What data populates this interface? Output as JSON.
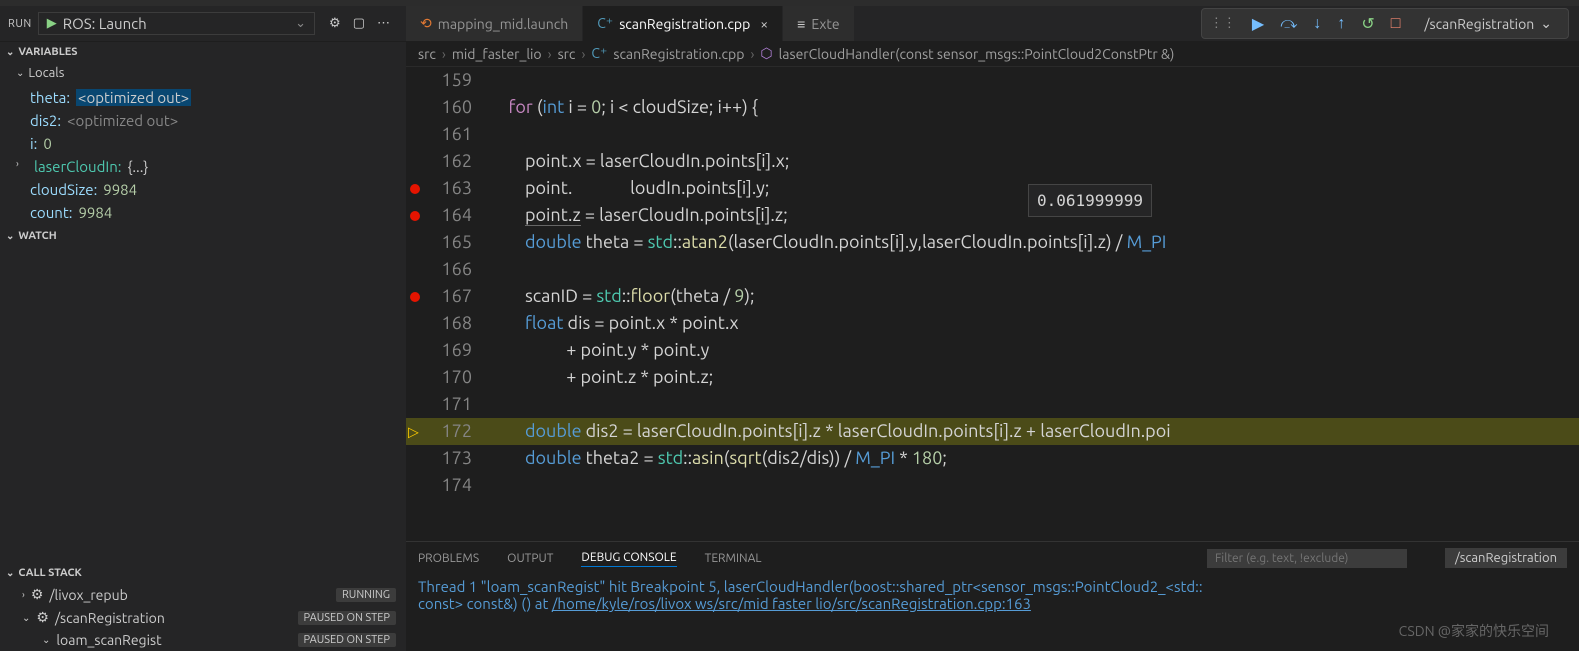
{
  "run": {
    "label": "RUN",
    "config": "ROS: Launch"
  },
  "sections": {
    "variables": "VARIABLES",
    "locals": "Locals",
    "watch": "WATCH",
    "callstack": "CALL STACK"
  },
  "vars": {
    "theta_name": "theta:",
    "theta_val": "<optimized out>",
    "dis2_name": "dis2:",
    "dis2_val": "<optimized out>",
    "i_name": "i:",
    "i_val": "0",
    "laser_name": "laserCloudIn:",
    "laser_val": "{...}",
    "cloudsize_name": "cloudSize:",
    "cloudsize_val": "9984",
    "count_name": "count:",
    "count_val": "9984"
  },
  "callstack": {
    "row1": {
      "name": "/livox_repub",
      "badge": "RUNNING"
    },
    "row2": {
      "name": "/scanRegistration",
      "badge": "PAUSED ON STEP"
    },
    "row3": {
      "name": "loam_scanRegist",
      "badge": "PAUSED ON STEP"
    }
  },
  "tabs": {
    "t1": "mapping_mid.launch",
    "t2": "scanRegistration.cpp",
    "t3": "Exte"
  },
  "debug_sel": "/scanRegistration",
  "breadcrumb": {
    "p1": "src",
    "p2": "mid_faster_lio",
    "p3": "src",
    "p4": "scanRegistration.cpp",
    "p5": "laserCloudHandler(const sensor_msgs::PointCloud2ConstPtr &)"
  },
  "hover": "0.061999999",
  "lines": {
    "l159": "159",
    "l160": "160",
    "l161": "161",
    "l162": "162",
    "l163": "163",
    "l164": "164",
    "l165": "165",
    "l166": "166",
    "l167": "167",
    "l168": "168",
    "l169": "169",
    "l170": "170",
    "l171": "171",
    "l172": "172",
    "l173": "173",
    "l174": "174"
  },
  "code": {
    "l160_for": "for",
    "l160_int": "int",
    "l160_rest1": " i = ",
    "l160_0": "0",
    "l160_rest2": "; i < cloudSize; i++) {",
    "l162": "point.x = laserCloudIn.points[i].x;",
    "l163": "point.",
    "l163b": "loudIn.points[i].y;",
    "l164": "point.z",
    "l164b": " = laserCloudIn.points[i].z;",
    "l165_dbl": "double",
    "l165_a": " theta = ",
    "l165_std": "std",
    "l165_atan": "atan2",
    "l165_b": "(laserCloudIn.points[i].y,laserCloudIn.points[i].z) / ",
    "l165_mpi": "M_PI",
    "l167_a": "scanID = ",
    "l167_std": "std",
    "l167_floor": "floor",
    "l167_b": "(theta / ",
    "l167_9": "9",
    "l167_c": ");",
    "l168_float": "float",
    "l168_a": " dis = point.x * point.x",
    "l169": "+ point.y * point.y",
    "l170": "+ point.z * point.z;",
    "l172_dbl": "double",
    "l172_a": " dis2 = laserCloudIn.points[i].z * laserCloudIn.points[i].z + laserCloudIn.poi",
    "l173_dbl": "double",
    "l173_a": " theta2 = ",
    "l173_std": "std",
    "l173_asin": "asin",
    "l173_b": "(",
    "l173_sqrt": "sqrt",
    "l173_c": "(dis2/dis)) / ",
    "l173_mpi": "M_PI",
    "l173_d": " * ",
    "l173_180": "180",
    "l173_e": ";"
  },
  "panel": {
    "problems": "PROBLEMS",
    "output": "OUTPUT",
    "debug": "DEBUG CONSOLE",
    "terminal": "TERMINAL",
    "filter_ph": "Filter (e.g. text, !exclude)",
    "sel": "/scanRegistration"
  },
  "console": {
    "l1a": "Thread 1 \"loam_scanRegist\" hit Breakpoint 5, laserCloudHandler(boost::shared_ptr<sensor_msgs::PointCloud2_<std::",
    "l2a": "const> const&) () at ",
    "l2b": "/home/kyle/ros/livox ws/src/mid faster lio/src/scanRegistration.cpp:163"
  },
  "watermark": "CSDN @家家的快乐空间"
}
